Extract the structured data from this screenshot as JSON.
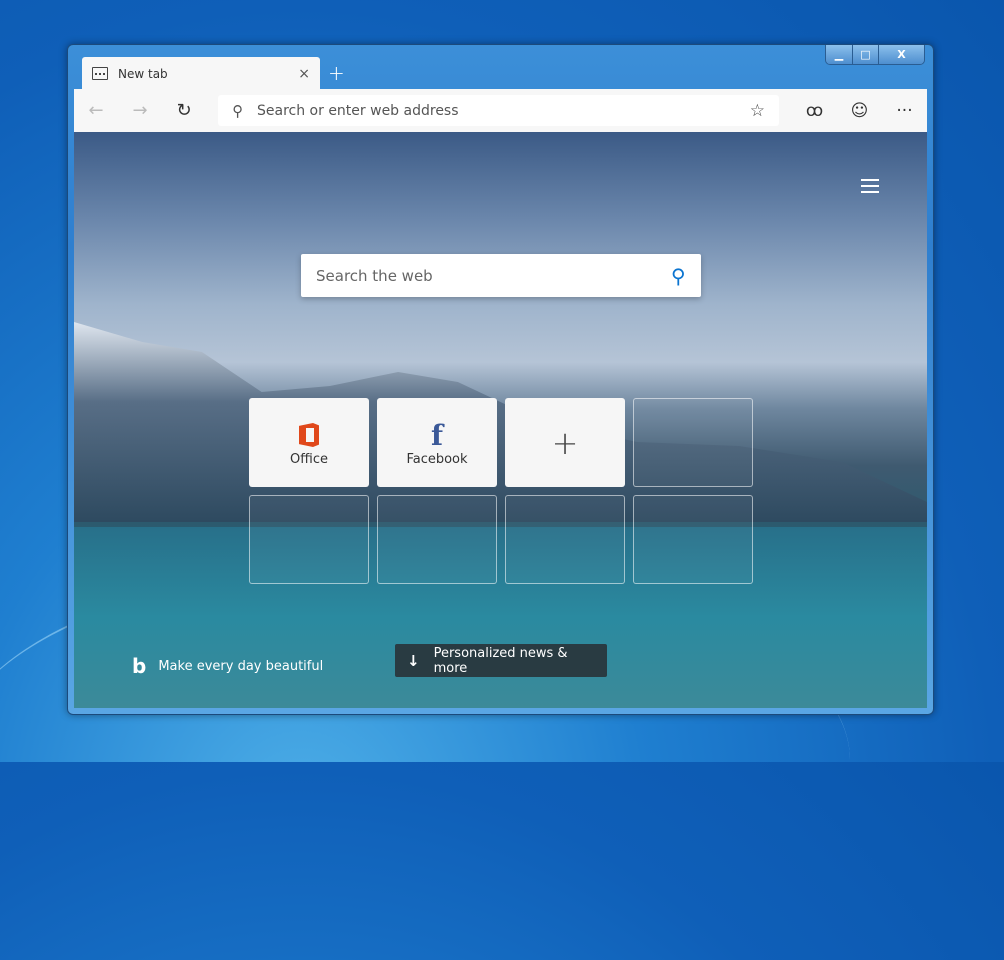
{
  "window": {
    "minimize": "▁",
    "maximize": "□",
    "close": "X"
  },
  "tab": {
    "title": "New tab",
    "close": "×",
    "new_tab": "+"
  },
  "toolbar": {
    "back": "←",
    "forward": "→",
    "refresh": "↻",
    "address_placeholder": "Search or enter web address",
    "favorite": "☆",
    "profile": "ꝏ",
    "feedback": "☺",
    "more": "···"
  },
  "page": {
    "search_placeholder": "Search the web",
    "tiles": [
      {
        "label": "Office",
        "icon": "office-icon"
      },
      {
        "label": "Facebook",
        "icon": "facebook-icon",
        "glyph": "f"
      },
      {
        "label": "",
        "icon": "add-icon",
        "glyph": "+"
      }
    ],
    "bing_text": "Make every day beautiful",
    "bing_glyph": "b",
    "news_button": "Personalized news & more",
    "news_glyph": "↓"
  }
}
